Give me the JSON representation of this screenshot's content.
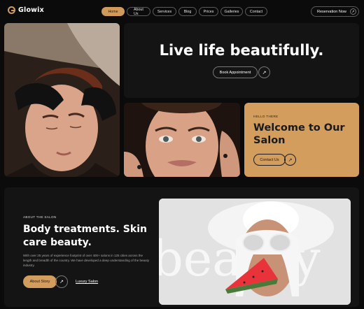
{
  "brand": {
    "name": "Glowix",
    "accent": "#d09b5a"
  },
  "nav": {
    "items": [
      "Home",
      "About Us",
      "Services",
      "Blog",
      "Prices",
      "Galleries",
      "Contact"
    ],
    "active": "Home"
  },
  "header": {
    "reservation_label": "Reservation Now"
  },
  "hero": {
    "title": "Live life beautifully.",
    "button_label": "Book Appointment"
  },
  "welcome": {
    "label": "HELLO THERE",
    "title": "Welcome to Our Salon",
    "button_label": "Contact Us"
  },
  "about": {
    "label": "ABOUT THE SALON",
    "title": "Body treatments. Skin care beauty.",
    "description": "With over 25 years of experience footprint of over 400+ salons in 125 cities across the length and breadth of the country. We have developed a deep understanding of the beauty industry.",
    "button_label": "About Story",
    "link_label": "Luxury Salon"
  },
  "photo_text": "beauty"
}
